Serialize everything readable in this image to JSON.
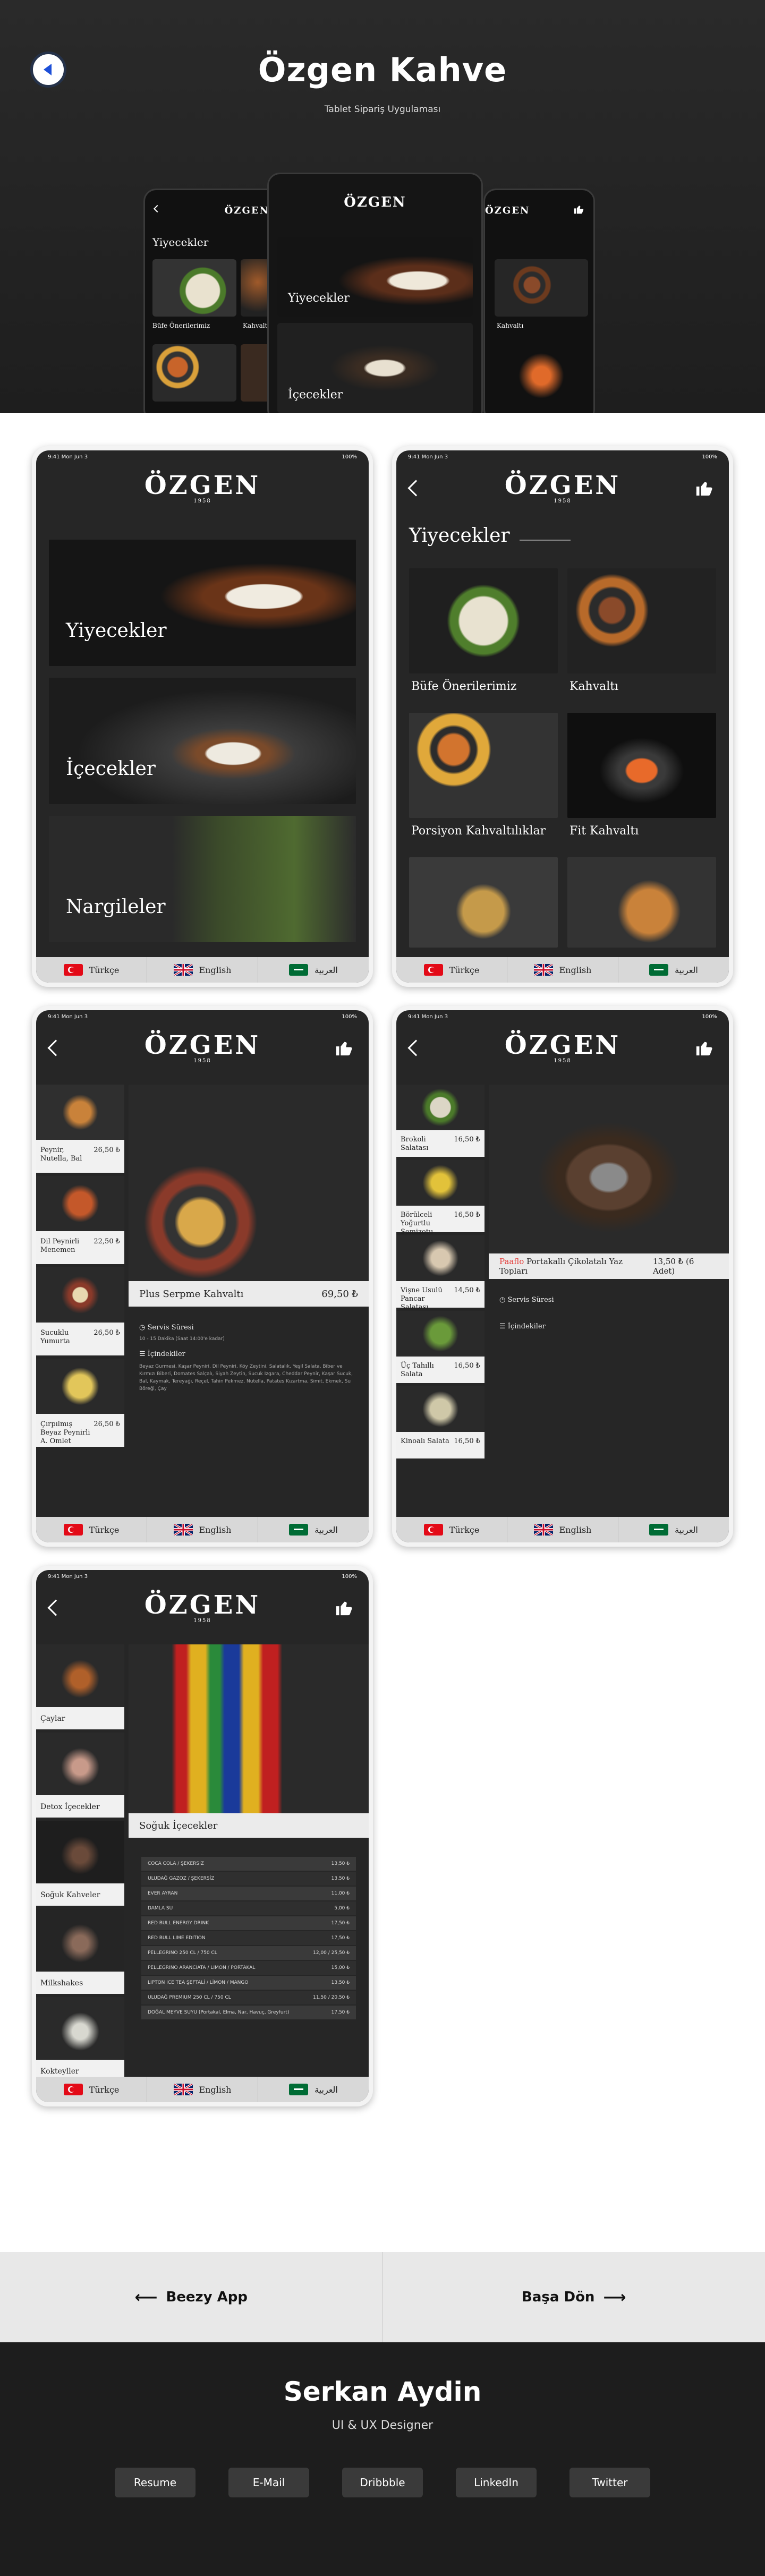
{
  "hero": {
    "title": "Özgen Kahve",
    "subtitle": "Tablet Sipariş Uygulaması",
    "mini_left": {
      "section": "Yiyecekler",
      "t1": "Büfe Önerilerimiz",
      "t2": "Kahvaltı"
    },
    "mini_center": {
      "c1": "Yiyecekler",
      "c2": "İçecekler"
    },
    "mini_right": {
      "t1": "Kahvaltı"
    }
  },
  "brand": {
    "logo": "ÖZGEN",
    "year": "1958"
  },
  "status": {
    "time": "9:41  Mon Jun 3",
    "battery": "100%"
  },
  "languages": [
    "Türkçe",
    "English",
    "العربية"
  ],
  "screen1": {
    "categories": [
      "Yiyecekler",
      "İçecekler",
      "Nargileler"
    ]
  },
  "screen2": {
    "section_title": "Yiyecekler",
    "tiles": [
      "Büfe Önerilerimiz",
      "Kahvaltı",
      "Porsiyon Kahvaltılıklar",
      "Fit Kahvaltı"
    ]
  },
  "screen3": {
    "side": [
      {
        "name": "Peynir, Nutella, Bal",
        "price": "26,50 ₺"
      },
      {
        "name": "Dil Peynirli Menemen",
        "price": "22,50 ₺"
      },
      {
        "name": "Sucuklu Yumurta",
        "price": "26,50 ₺"
      },
      {
        "name": "Çırpılmış Beyaz Peynirli A. Omlet",
        "price": "26,50 ₺"
      }
    ],
    "product": "Plus Serpme Kahvaltı",
    "price": "69,50 ₺",
    "service": "Servis Süresi",
    "service_detail": "10 - 15 Dakika (Saat 14:00'e kadar)",
    "ingredients_label": "İçindekiler",
    "ingredients": "Beyaz Gurmesi, Kaşar Peyniri, Dil Peyniri, Köy Zeytini, Salatalık, Yeşil Salata, Biber ve Kırmızı Biberi, Domates Salçalı, Siyah Zeytin, Sucuk Izgara, Cheddar Peynir, Kaşar Sucuk, Bal, Kaymak, Tereyağı, Reçel, Tahin Pekmez, Nutella, Patates Kızartma, Simit, Ekmek, Su Böreği, Çay"
  },
  "screen4": {
    "side": [
      {
        "name": "Brokoli Salatası",
        "price": "16,50 ₺"
      },
      {
        "name": "Börülceli Yoğurtlu Semizotu",
        "price": "16,50 ₺"
      },
      {
        "name": "Vişne Usulü Pancar Salatası",
        "price": "14,50 ₺"
      },
      {
        "name": "Üç Tahıllı Salata",
        "price": "16,50 ₺"
      },
      {
        "name": "Kinoalı Salata",
        "price": "16,50 ₺"
      }
    ],
    "product_prefix": "Paaflo",
    "product": "Portakallı Çikolatalı Yaz Topları",
    "price": "13,50 ₺ (6 Adet)",
    "service": "Servis Süresi",
    "ingredients_label": "İçindekiler"
  },
  "screen5": {
    "side": [
      "Çaylar",
      "Detox İçecekler",
      "Soğuk Kahveler",
      "Milkshakes",
      "Kokteyller"
    ],
    "section": "Soğuk İçecekler",
    "rows": [
      {
        "name": "COCA COLA / ŞEKERSİZ",
        "price": "13,50 ₺"
      },
      {
        "name": "ULUDAĞ GAZOZ / ŞEKERSİZ",
        "price": "13,50 ₺"
      },
      {
        "name": "EVER AYRAN",
        "price": "11,00 ₺"
      },
      {
        "name": "DAMLA SU",
        "price": "5,00 ₺"
      },
      {
        "name": "RED BULL ENERGY DRINK",
        "price": "17,50 ₺"
      },
      {
        "name": "RED BULL LIME EDITION",
        "price": "17,50 ₺"
      },
      {
        "name": "PELLEGRINO 250 CL / 750 CL",
        "price": "12,00 / 25,50 ₺"
      },
      {
        "name": "PELLEGRINO ARANCIATA / LIMON / PORTAKAL",
        "price": "15,00 ₺"
      },
      {
        "name": "LIPTON ICE TEA ŞEFTALİ / LİMON / MANGO",
        "price": "13,50 ₺"
      },
      {
        "name": "ULUDAĞ PREMIUM 250 CL / 750 CL",
        "price": "11,50 / 20,50 ₺"
      },
      {
        "name": "DOĞAL MEYVE SUYU (Portakal, Elma, Nar, Havuç, Greyfurt)",
        "price": "17,50 ₺"
      }
    ]
  },
  "footer_nav": {
    "prev": "Beezy App",
    "next": "Başa Dön"
  },
  "designer": {
    "name": "Serkan Aydin",
    "role": "UI & UX Designer",
    "links": [
      "Resume",
      "E-Mail",
      "Dribbble",
      "LinkedIn",
      "Twitter"
    ]
  },
  "colors": {
    "accent": "#1d4fd8",
    "dark": "#262626",
    "red": "#e53935"
  }
}
